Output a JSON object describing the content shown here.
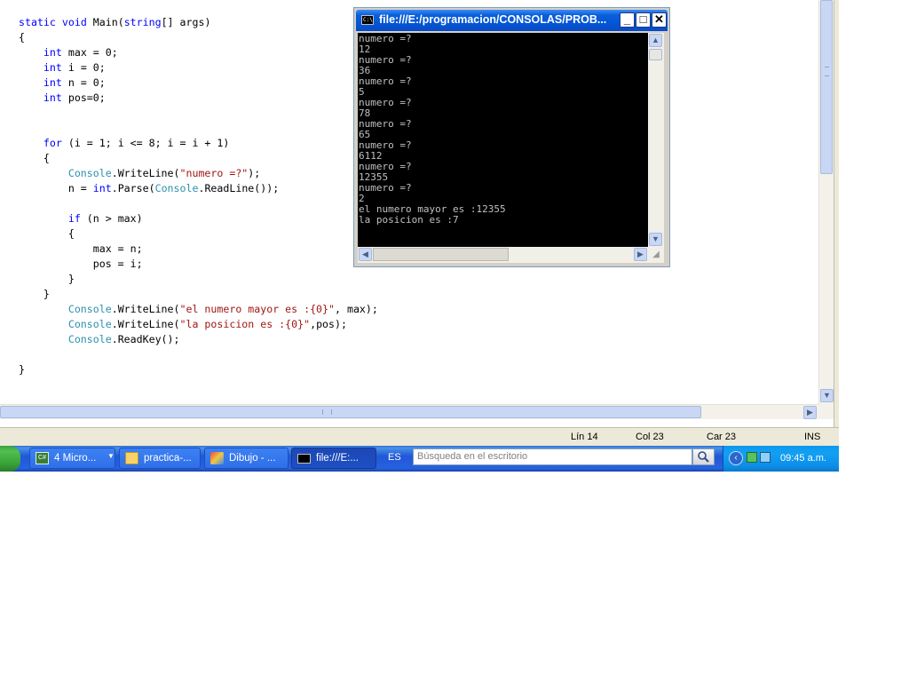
{
  "editor": {
    "code_lines": [
      [
        {
          "t": "static void Main(string[] args)",
          "c": "kw-mixed"
        }
      ],
      [
        {
          "t": "{",
          "c": ""
        }
      ],
      [
        {
          "t": "    ",
          "c": ""
        },
        {
          "t": "int",
          "c": "kw"
        },
        {
          "t": " max = 0;",
          "c": ""
        }
      ],
      [
        {
          "t": "    ",
          "c": ""
        },
        {
          "t": "int",
          "c": "kw"
        },
        {
          "t": " i = 0;",
          "c": ""
        }
      ],
      [
        {
          "t": "    ",
          "c": ""
        },
        {
          "t": "int",
          "c": "kw"
        },
        {
          "t": " n = 0;",
          "c": ""
        }
      ],
      [
        {
          "t": "    ",
          "c": ""
        },
        {
          "t": "int",
          "c": "kw"
        },
        {
          "t": " pos=0;",
          "c": ""
        }
      ],
      [],
      [],
      [
        {
          "t": "    ",
          "c": ""
        },
        {
          "t": "for",
          "c": "kw"
        },
        {
          "t": " (i = 1; i <= 8; i = i + 1)",
          "c": ""
        }
      ],
      [
        {
          "t": "    {",
          "c": ""
        }
      ],
      [
        {
          "t": "        ",
          "c": ""
        },
        {
          "t": "Console",
          "c": "cls"
        },
        {
          "t": ".WriteLine(",
          "c": ""
        },
        {
          "t": "\"numero =?\"",
          "c": "str"
        },
        {
          "t": ");",
          "c": ""
        }
      ],
      [
        {
          "t": "        n = ",
          "c": ""
        },
        {
          "t": "int",
          "c": "kw"
        },
        {
          "t": ".Parse(",
          "c": ""
        },
        {
          "t": "Console",
          "c": "cls"
        },
        {
          "t": ".ReadLine());",
          "c": ""
        }
      ],
      [],
      [
        {
          "t": "        ",
          "c": ""
        },
        {
          "t": "if",
          "c": "kw"
        },
        {
          "t": " (n > max)",
          "c": ""
        }
      ],
      [
        {
          "t": "        {",
          "c": ""
        }
      ],
      [
        {
          "t": "            max = n;",
          "c": ""
        }
      ],
      [
        {
          "t": "            pos = i;",
          "c": ""
        }
      ],
      [
        {
          "t": "        }",
          "c": ""
        }
      ],
      [
        {
          "t": "    }",
          "c": ""
        }
      ],
      [
        {
          "t": "        ",
          "c": ""
        },
        {
          "t": "Console",
          "c": "cls"
        },
        {
          "t": ".WriteLine(",
          "c": ""
        },
        {
          "t": "\"el numero mayor es :{0}\"",
          "c": "str"
        },
        {
          "t": ", max);",
          "c": ""
        }
      ],
      [
        {
          "t": "        ",
          "c": ""
        },
        {
          "t": "Console",
          "c": "cls"
        },
        {
          "t": ".WriteLine(",
          "c": ""
        },
        {
          "t": "\"la posicion es :{0}\"",
          "c": "str"
        },
        {
          "t": ",pos);",
          "c": ""
        }
      ],
      [
        {
          "t": "        ",
          "c": ""
        },
        {
          "t": "Console",
          "c": "cls"
        },
        {
          "t": ".ReadKey();",
          "c": ""
        }
      ],
      [],
      [
        {
          "t": "}",
          "c": ""
        }
      ]
    ]
  },
  "statusbar": {
    "line": "Lín 14",
    "col": "Col 23",
    "car": "Car 23",
    "mode": "INS"
  },
  "console": {
    "title": "file:///E:/programacion/CONSOLAS/PROB...",
    "icon_label": "C:\\",
    "buttons": {
      "minimize": "_",
      "maximize": "□",
      "close": "✕"
    },
    "output_lines": [
      "numero =?",
      "12",
      "numero =?",
      "36",
      "numero =?",
      "5",
      "numero =?",
      "78",
      "numero =?",
      "65",
      "numero =?",
      "6112",
      "numero =?",
      "12355",
      "numero =?",
      "2",
      "el numero mayor es :12355",
      "la posicion es :7"
    ]
  },
  "taskbar": {
    "tasks": [
      {
        "label": "4 Micro...",
        "icon": "visual-csharp-icon",
        "active": false
      },
      {
        "label": "practica-...",
        "icon": "folder-icon",
        "active": false
      },
      {
        "label": "Dibujo - ...",
        "icon": "paint-icon",
        "active": false
      },
      {
        "label": "file:///E:...",
        "icon": "console-icon",
        "active": true
      }
    ],
    "language": "ES",
    "search_placeholder": "Búsqueda en el escritorio",
    "clock": "09:45 a.m."
  },
  "colors": {
    "keyword": "#0000ff",
    "class": "#2b91af",
    "string": "#a31515",
    "console_bg": "#000000",
    "console_text": "#c0c0c0",
    "taskbar": "#2157d7"
  }
}
